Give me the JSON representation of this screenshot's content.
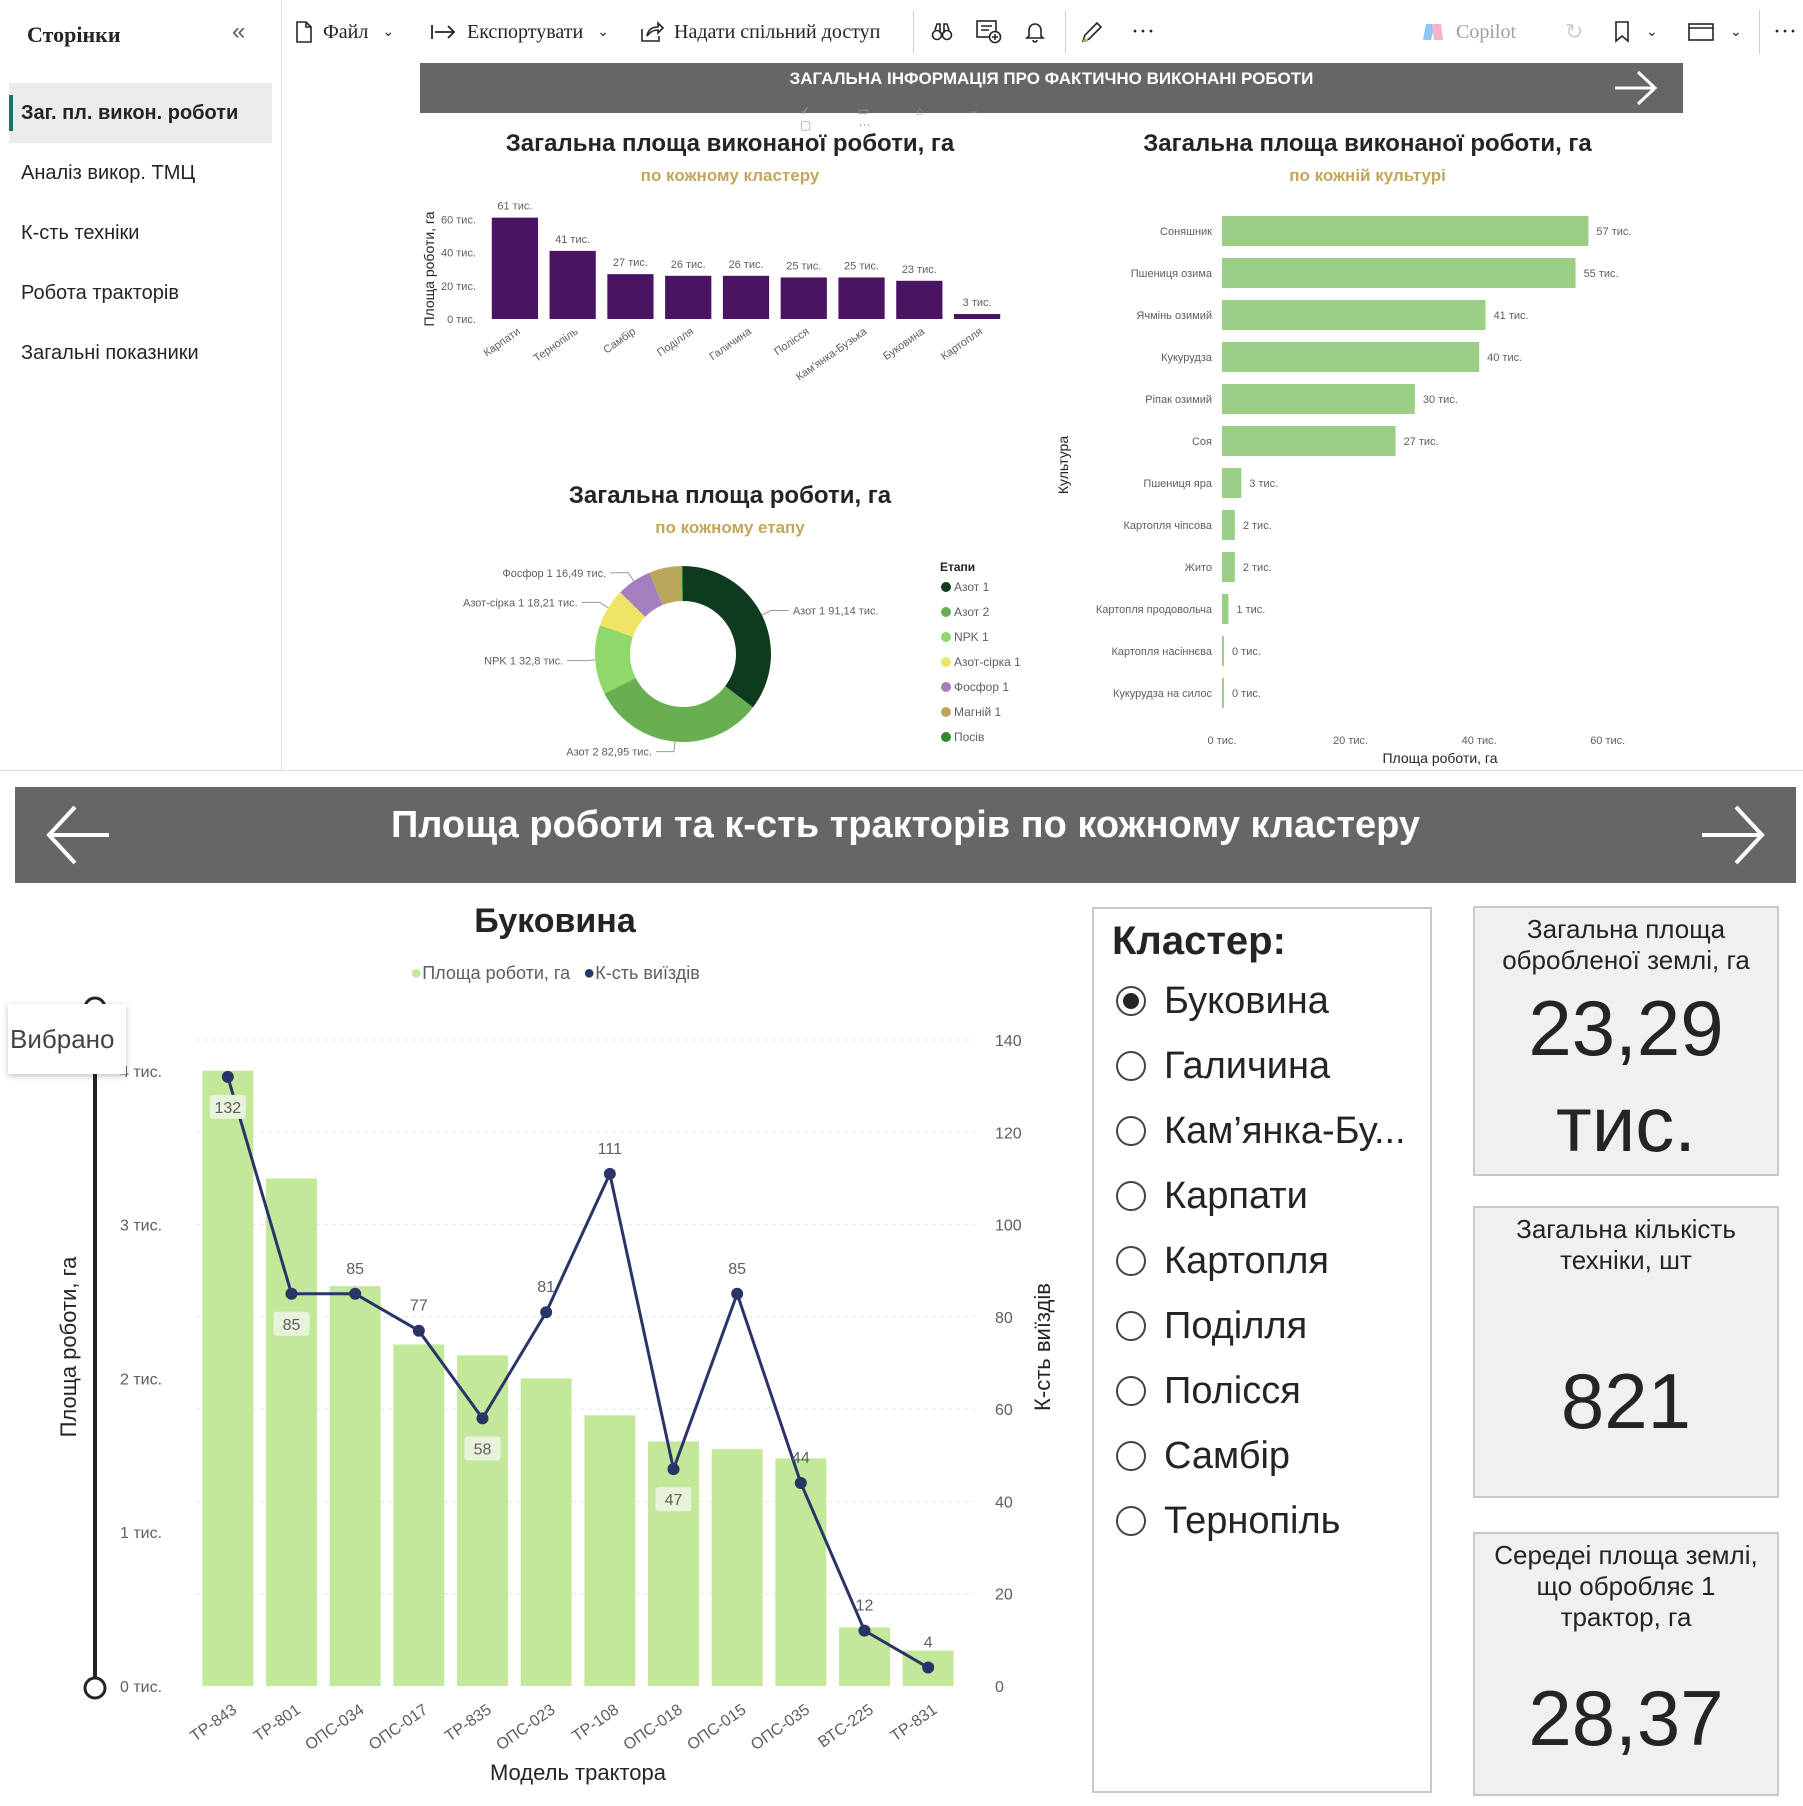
{
  "sidebar": {
    "title": "Сторінки",
    "items": [
      {
        "label": "Заг. пл. викон. роботи",
        "active": true
      },
      {
        "label": "Аналіз викор. ТМЦ",
        "active": false
      },
      {
        "label": "К-сть техніки",
        "active": false
      },
      {
        "label": "Робота тракторів",
        "active": false
      },
      {
        "label": "Загальні показники",
        "active": false
      }
    ]
  },
  "toolbar": {
    "file": "Файл",
    "export": "Експортувати",
    "share": "Надати спільний доступ",
    "copilot": "Copilot"
  },
  "report1": {
    "banner": "ЗАГАЛЬНА ІНФОРМАЦІЯ ПРО ФАКТИЧНО ВИКОНАНІ РОБОТИ"
  },
  "report2": {
    "banner": "Площа роботи та к-сть тракторів по кожному кластеру",
    "tooltip": "Вибрано",
    "slicer": {
      "title": "Кластер:",
      "options": [
        "Буковина",
        "Галичина",
        "Кам’янка-Бу...",
        "Карпати",
        "Картопля",
        "Поділля",
        "Полісся",
        "Самбір",
        "Тернопіль"
      ],
      "selected": "Буковина"
    },
    "cards": [
      {
        "label": "Загальна площа обробленої землі, га",
        "value": "23,29 тис."
      },
      {
        "label": "Загальна кількість техніки, шт",
        "value": "821"
      },
      {
        "label": "Середеі площа землі, що обробляє 1 трактор, га",
        "value": "28,37"
      }
    ]
  },
  "colors": {
    "purple": "#4b1463",
    "green_bar": "#9bcf86",
    "light_green": "#c3e89a",
    "navy": "#2a3466",
    "gold": "#c2a65a",
    "banner": "#666666"
  },
  "chart_data": [
    {
      "type": "bar",
      "title": "Загальна площа виконаної роботи, га",
      "subtitle": "по кожному кластеру",
      "ylabel": "Площа роботи, га",
      "categories": [
        "Карпати",
        "Тернопіль",
        "Самбір",
        "Поділля",
        "Галичина",
        "Полісся",
        "Кам'янка-Бузька",
        "Буковина",
        "Картопля"
      ],
      "values": [
        61,
        41,
        27,
        26,
        26,
        25,
        25,
        23,
        3
      ],
      "data_labels": [
        "61 тис.",
        "41 тис.",
        "27 тис.",
        "26 тис.",
        "26 тис.",
        "25 тис.",
        "25 тис.",
        "23 тис.",
        "3 тис."
      ],
      "yticks": [
        "0 тис.",
        "20 тис.",
        "40 тис.",
        "60 тис."
      ],
      "ylim": [
        0,
        65
      ]
    },
    {
      "type": "bar",
      "orientation": "horizontal",
      "title": "Загальна площа виконаної роботи, га",
      "subtitle": "по кожній культурі",
      "xlabel": "Площа роботи, га",
      "ylabel": "Культура",
      "categories": [
        "Соняшник",
        "Пшениця озима",
        "Ячмінь озимий",
        "Кукурудза",
        "Ріпак озимий",
        "Соя",
        "Пшениця яра",
        "Картопля чіпсова",
        "Жито",
        "Картопля продовольча",
        "Картопля насіннєва",
        "Кукурудза на силос"
      ],
      "values": [
        57,
        55,
        41,
        40,
        30,
        27,
        3,
        2,
        2,
        1,
        0.3,
        0.2
      ],
      "data_labels": [
        "57 тис.",
        "55 тис.",
        "41 тис.",
        "40 тис.",
        "30 тис.",
        "27 тис.",
        "3 тис.",
        "2 тис.",
        "2 тис.",
        "1 тис.",
        "0 тис.",
        "0 тис."
      ],
      "xticks": [
        "0 тис.",
        "20 тис.",
        "40 тис.",
        "60 тис."
      ],
      "xlim": [
        0,
        63
      ]
    },
    {
      "type": "pie",
      "title": "Загальна площа роботи, га",
      "subtitle": "по кожному етапу",
      "legend_title": "Етапи",
      "legend": [
        "Азот 1",
        "Азот 2",
        "NPK 1",
        "Азот-сірка 1",
        "Фосфор 1",
        "Магній 1",
        "Посів"
      ],
      "slices": [
        {
          "name": "Азот 1",
          "value": 91.14,
          "label": "Азот 1 91,14 тис.",
          "color": "#0e3b1e"
        },
        {
          "name": "Азот 2",
          "value": 82.95,
          "label": "Азот 2 82,95 тис.",
          "color": "#6aae52"
        },
        {
          "name": "NPK 1",
          "value": 32.8,
          "label": "NPK 1 32,8 тис.",
          "color": "#90d86a"
        },
        {
          "name": "Азот-сірка 1",
          "value": 18.21,
          "label": "Азот-сірка 1 18,21 тис.",
          "color": "#f0e467"
        },
        {
          "name": "Фосфор 1",
          "value": 16.49,
          "label": "Фосфор 1 16,49 тис.",
          "color": "#a47fc0"
        },
        {
          "name": "Магній 1",
          "value": 15.5,
          "label": "",
          "color": "#b9a55c"
        },
        {
          "name": "Посів",
          "value": 0.6,
          "label": "",
          "color": "#2f8a2f"
        }
      ]
    },
    {
      "type": "bar",
      "title": "Буковина",
      "xlabel": "Модель трактора",
      "ylabel": "Площа роботи, га",
      "y2label": "К-сть виїздів",
      "categories": [
        "ТР-843",
        "ТР-801",
        "ОПС-034",
        "ОПС-017",
        "ТР-835",
        "ОПС-023",
        "ТР-108",
        "ОПС-018",
        "ОПС-015",
        "ОПС-035",
        "ВТС-225",
        "ТР-831"
      ],
      "series": [
        {
          "name": "Площа роботи, га",
          "type": "bar",
          "values": [
            4000,
            3300,
            2600,
            2220,
            2150,
            2000,
            1760,
            1590,
            1540,
            1480,
            380,
            230
          ]
        },
        {
          "name": "К-сть виїздів",
          "type": "line",
          "axis": "right",
          "values": [
            132,
            85,
            85,
            77,
            58,
            81,
            111,
            47,
            85,
            44,
            12,
            4
          ]
        }
      ],
      "yticks": [
        "0 тис.",
        "1 тис.",
        "2 тис.",
        "3 тис.",
        "4 тис."
      ],
      "ylim": [
        0,
        4200
      ],
      "y2ticks": [
        "0",
        "20",
        "40",
        "60",
        "80",
        "100",
        "120",
        "140"
      ],
      "y2lim": [
        0,
        140
      ]
    }
  ]
}
